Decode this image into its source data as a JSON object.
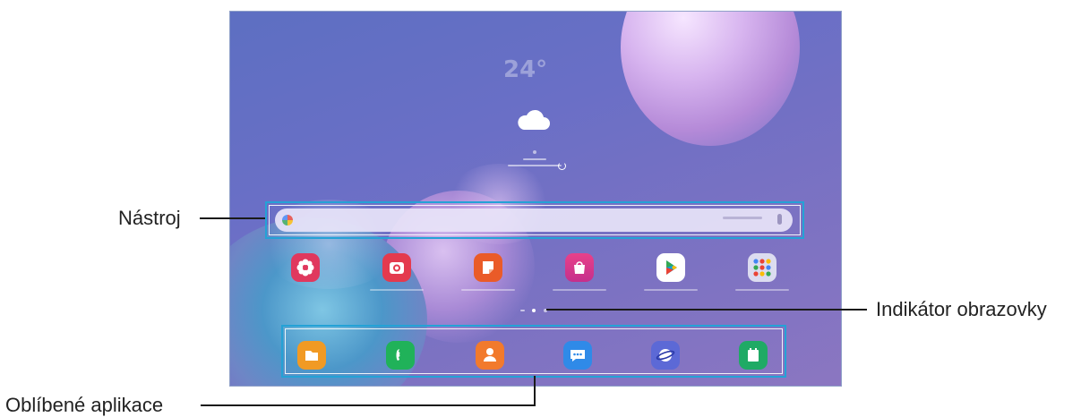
{
  "callouts": {
    "tool": "Nástroj",
    "screen_indicator": "Indikátor obrazovky",
    "favorite_apps": "Oblíbené aplikace"
  },
  "weather": {
    "temperature": "24°",
    "icon": "cloud-icon"
  },
  "home_apps": [
    {
      "icon": "gallery-icon",
      "color": "#e0385e"
    },
    {
      "icon": "camera-icon",
      "color": "#e43a4e"
    },
    {
      "icon": "notes-icon",
      "color": "#ea5b28"
    },
    {
      "icon": "galaxy-store-icon",
      "color": "#d93a8e"
    },
    {
      "icon": "play-store-icon",
      "color": "#ffffff"
    },
    {
      "icon": "folder-icon",
      "color": "#dcdcf0"
    }
  ],
  "dock_apps": [
    {
      "icon": "my-files-icon",
      "color": "#f19a24"
    },
    {
      "icon": "phone-icon",
      "color": "#20b259"
    },
    {
      "icon": "contacts-icon",
      "color": "#f27a2c"
    },
    {
      "icon": "messages-icon",
      "color": "#2f8ae8"
    },
    {
      "icon": "internet-icon",
      "color": "#5c69d6"
    },
    {
      "icon": "calendar-icon",
      "color": "#1faa65"
    }
  ]
}
